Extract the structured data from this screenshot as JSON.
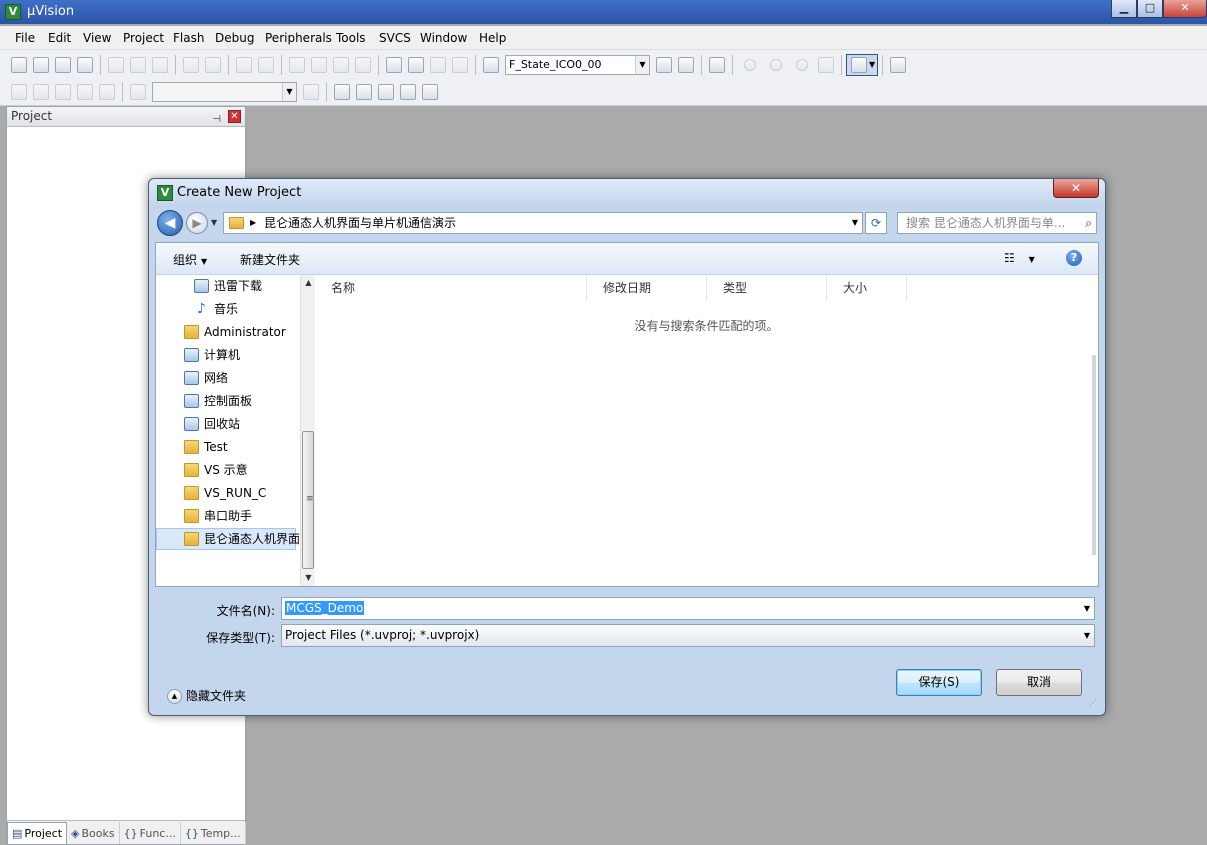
{
  "app": {
    "title": "µVision",
    "icon_letter": "V",
    "window_buttons": {
      "minimize": "▁",
      "maximize": "□",
      "close": "✕"
    }
  },
  "menu": [
    "File",
    "Edit",
    "View",
    "Project",
    "Flash",
    "Debug",
    "Peripherals",
    "Tools",
    "SVCS",
    "Window",
    "Help"
  ],
  "toolbar": {
    "target_combo": "F_State_ICO0_00",
    "second_combo": ""
  },
  "project_pane": {
    "title": "Project",
    "pin": "⊣",
    "close": "✕",
    "tabs": [
      {
        "icon": "▤",
        "label": "Project"
      },
      {
        "icon": "◈",
        "label": "Books"
      },
      {
        "icon": "{}",
        "label": "Func..."
      },
      {
        "icon": "{}",
        "label": "Temp..."
      }
    ]
  },
  "dialog": {
    "title": "Create New Project",
    "close": "✕",
    "address_path": "昆仑通态人机界面与单片机通信演示",
    "search_placeholder": "搜索 昆仑通态人机界面与单...",
    "organize": "组织",
    "new_folder": "新建文件夹",
    "nav_items": [
      {
        "label": "迅雷下载",
        "icon": "box",
        "indent": 1
      },
      {
        "label": "音乐",
        "icon": "note",
        "indent": 1
      },
      {
        "label": "Administrator",
        "icon": "folder",
        "indent": 0
      },
      {
        "label": "计算机",
        "icon": "box",
        "indent": 0
      },
      {
        "label": "网络",
        "icon": "box",
        "indent": 0
      },
      {
        "label": "控制面板",
        "icon": "box",
        "indent": 0
      },
      {
        "label": "回收站",
        "icon": "box",
        "indent": 0
      },
      {
        "label": "Test",
        "icon": "folder",
        "indent": 0
      },
      {
        "label": "VS 示意",
        "icon": "folder",
        "indent": 0
      },
      {
        "label": "VS_RUN_C",
        "icon": "folder",
        "indent": 0
      },
      {
        "label": "串口助手",
        "icon": "folder",
        "indent": 0
      },
      {
        "label": "昆仑通态人机界面",
        "icon": "folder",
        "indent": 0,
        "selected": true
      }
    ],
    "columns": [
      "名称",
      "修改日期",
      "类型",
      "大小"
    ],
    "empty_message": "没有与搜索条件匹配的项。",
    "filename_label": "文件名(N):",
    "filename_value": "MCGS_Demo",
    "filetype_label": "保存类型(T):",
    "filetype_value": "Project Files (*.uvproj; *.uvprojx)",
    "hide_folders": "隐藏文件夹",
    "save_button": "保存(S)",
    "cancel_button": "取消"
  }
}
